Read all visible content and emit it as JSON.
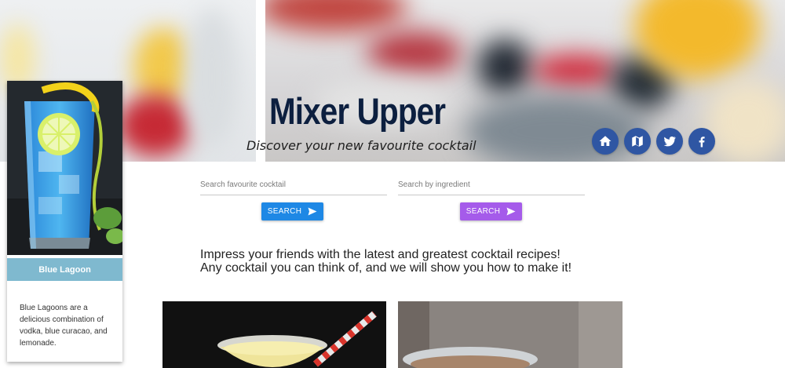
{
  "header": {
    "title": "Mixer Upper",
    "tagline": "Discover your new favourite cocktail"
  },
  "social": [
    {
      "icon": "home-icon",
      "name": "Home"
    },
    {
      "icon": "map-icon",
      "name": "Map"
    },
    {
      "icon": "twitter-icon",
      "name": "Twitter"
    },
    {
      "icon": "facebook-icon",
      "name": "Facebook"
    }
  ],
  "featured": {
    "name": "Blue Lagoon",
    "description": "Blue Lagoons are a delicious combination of vodka, blue curacao, and lemonade."
  },
  "search": {
    "cocktail": {
      "placeholder": "Search favourite cocktail",
      "value": "",
      "button_label": "SEARCH"
    },
    "ingredient": {
      "placeholder": "Search by ingredient",
      "value": "",
      "button_label": "SEARCH"
    }
  },
  "intro": {
    "line1": "Impress your friends with the latest and greatest cocktail recipes!",
    "line2": "Any cocktail you can think of, and we will show you how to make it!"
  },
  "colors": {
    "title": "#0c1f3f",
    "social_button": "#2f56a3",
    "cocktail_search_button": "#1e88e5",
    "ingredient_search_button": "#a55bea",
    "featured_label_bg": "#7fb9cf"
  }
}
